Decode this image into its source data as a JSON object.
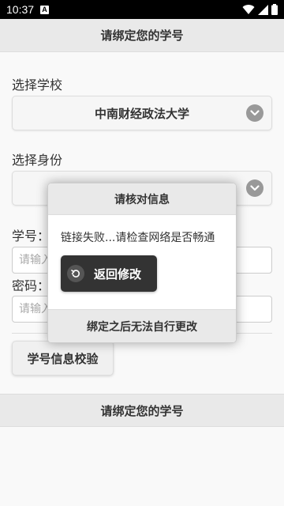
{
  "status_bar": {
    "time": "10:37",
    "notification_badge": "A"
  },
  "header": {
    "title": "请绑定您的学号"
  },
  "school": {
    "label": "选择学校",
    "selected": "中南财经政法大学"
  },
  "identity": {
    "label": "选择身份",
    "selected": ""
  },
  "student_id": {
    "label": "学号：",
    "placeholder": "请输入"
  },
  "password": {
    "label": "密码：",
    "placeholder": "请输入"
  },
  "verify_button": {
    "label": "学号信息校验"
  },
  "footer": {
    "text": "请绑定您的学号"
  },
  "dialog": {
    "title": "请核对信息",
    "message": "链接失败...请检查网络是否畅通",
    "back_button": "返回修改",
    "footer": "绑定之后无法自行更改"
  }
}
